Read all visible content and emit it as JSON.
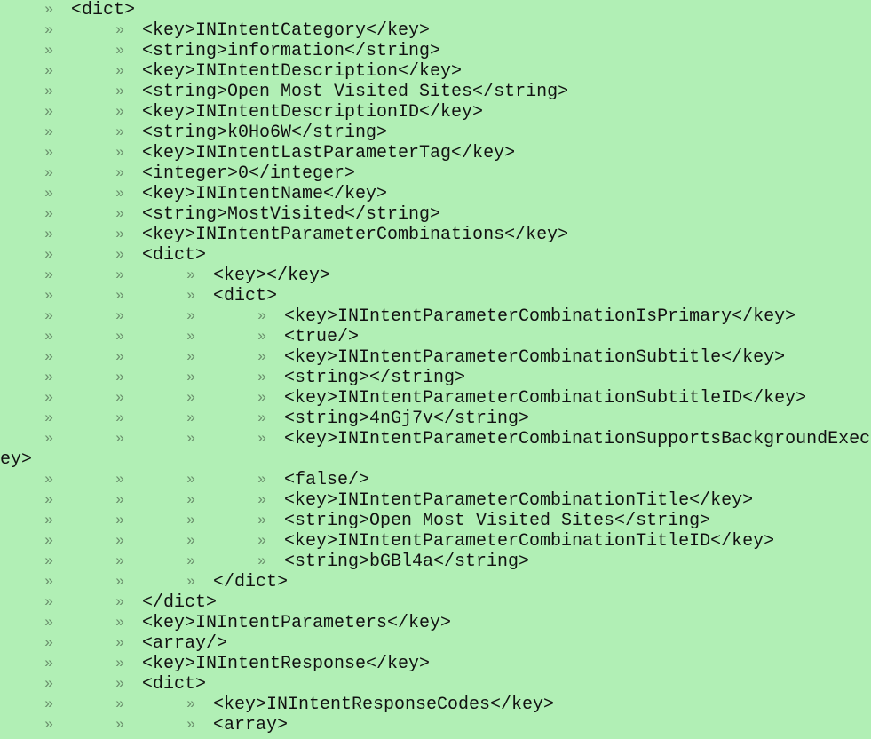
{
  "lines": [
    {
      "indent": 1,
      "text": "<dict>"
    },
    {
      "indent": 2,
      "text": "<key>INIntentCategory</key>"
    },
    {
      "indent": 2,
      "text": "<string>information</string>"
    },
    {
      "indent": 2,
      "text": "<key>INIntentDescription</key>"
    },
    {
      "indent": 2,
      "text": "<string>Open Most Visited Sites</string>"
    },
    {
      "indent": 2,
      "text": "<key>INIntentDescriptionID</key>"
    },
    {
      "indent": 2,
      "text": "<string>k0Ho6W</string>"
    },
    {
      "indent": 2,
      "text": "<key>INIntentLastParameterTag</key>"
    },
    {
      "indent": 2,
      "text": "<integer>0</integer>"
    },
    {
      "indent": 2,
      "text": "<key>INIntentName</key>"
    },
    {
      "indent": 2,
      "text": "<string>MostVisited</string>"
    },
    {
      "indent": 2,
      "text": "<key>INIntentParameterCombinations</key>"
    },
    {
      "indent": 2,
      "text": "<dict>"
    },
    {
      "indent": 3,
      "text": "<key></key>"
    },
    {
      "indent": 3,
      "text": "<dict>"
    },
    {
      "indent": 4,
      "text": "<key>INIntentParameterCombinationIsPrimary</key>"
    },
    {
      "indent": 4,
      "text": "<true/>"
    },
    {
      "indent": 4,
      "text": "<key>INIntentParameterCombinationSubtitle</key>"
    },
    {
      "indent": 4,
      "text": "<string></string>"
    },
    {
      "indent": 4,
      "text": "<key>INIntentParameterCombinationSubtitleID</key>"
    },
    {
      "indent": 4,
      "text": "<string>4nGj7v</string>"
    },
    {
      "indent": 4,
      "text": "<key>INIntentParameterCombinationSupportsBackgroundExecution",
      "wrap": "ey>"
    },
    {
      "indent": 4,
      "text": "<false/>"
    },
    {
      "indent": 4,
      "text": "<key>INIntentParameterCombinationTitle</key>"
    },
    {
      "indent": 4,
      "text": "<string>Open Most Visited Sites</string>"
    },
    {
      "indent": 4,
      "text": "<key>INIntentParameterCombinationTitleID</key>"
    },
    {
      "indent": 4,
      "text": "<string>bGBl4a</string>"
    },
    {
      "indent": 3,
      "text": "</dict>"
    },
    {
      "indent": 2,
      "text": "</dict>"
    },
    {
      "indent": 2,
      "text": "<key>INIntentParameters</key>"
    },
    {
      "indent": 2,
      "text": "<array/>"
    },
    {
      "indent": 2,
      "text": "<key>INIntentResponse</key>"
    },
    {
      "indent": 2,
      "text": "<dict>"
    },
    {
      "indent": 3,
      "text": "<key>INIntentResponseCodes</key>"
    },
    {
      "indent": 3,
      "text": "<array>"
    }
  ]
}
